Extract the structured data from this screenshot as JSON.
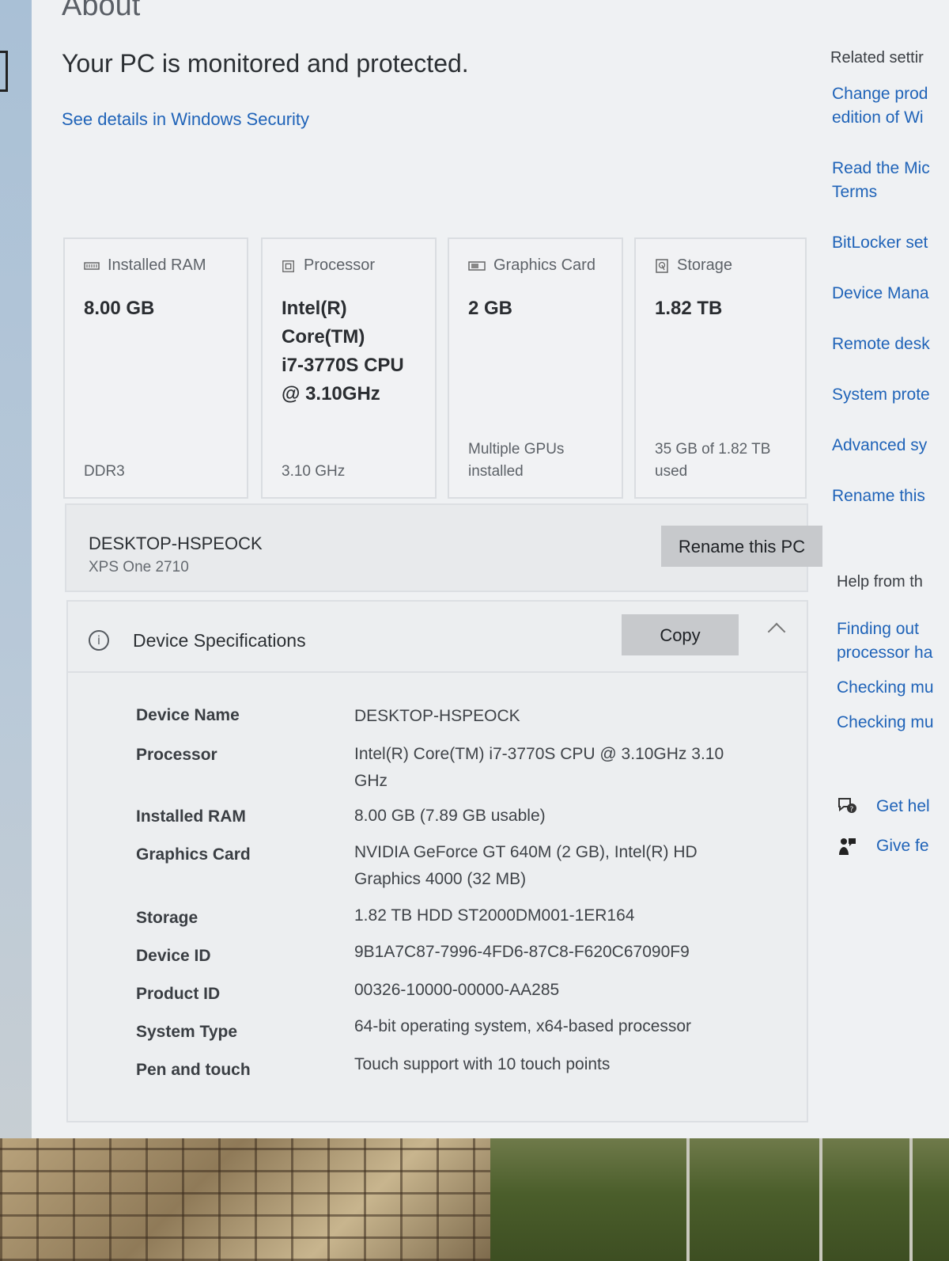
{
  "page": {
    "title": "About"
  },
  "security": {
    "status": "Your PC is monitored and protected.",
    "link": "See details in Windows Security"
  },
  "cards": [
    {
      "header": "Installed RAM",
      "icon": "ram-icon",
      "value": "8.00 GB",
      "footer": "DDR3"
    },
    {
      "header": "Processor",
      "icon": "processor-icon",
      "value": "Intel(R)\nCore(TM)\ni7-3770S CPU\n@ 3.10GHz",
      "footer": "3.10 GHz"
    },
    {
      "header": "Graphics Card",
      "icon": "graphics-card-icon",
      "value": "2 GB",
      "footer": "Multiple GPUs\ninstalled"
    },
    {
      "header": "Storage",
      "icon": "storage-icon",
      "value": "1.82 TB",
      "footer": "35 GB of 1.82 TB\nused"
    }
  ],
  "rename_panel": {
    "pc_name": "DESKTOP-HSPEOCK",
    "model": "XPS One 2710",
    "button": "Rename this PC"
  },
  "specs": {
    "title": "Device Specifications",
    "copy_button": "Copy",
    "rows": [
      {
        "label": "Device Name",
        "value": "DESKTOP-HSPEOCK"
      },
      {
        "label": "Processor",
        "value": "Intel(R) Core(TM) i7-3770S CPU @ 3.10GHz   3.10 GHz"
      },
      {
        "label": "Installed RAM",
        "value": "8.00 GB (7.89 GB usable)"
      },
      {
        "label": "Graphics Card",
        "value": "NVIDIA GeForce GT 640M (2 GB), Intel(R) HD Graphics 4000 (32 MB)"
      },
      {
        "label": "Storage",
        "value": "1.82 TB HDD ST2000DM001-1ER164"
      },
      {
        "label": "Device ID",
        "value": "9B1A7C87-7996-4FD6-87C8-F620C67090F9"
      },
      {
        "label": "Product ID",
        "value": "00326-10000-00000-AA285"
      },
      {
        "label": "System Type",
        "value": "64-bit operating system, x64-based processor"
      },
      {
        "label": "Pen and touch",
        "value": "Touch support with 10 touch points"
      }
    ]
  },
  "related": {
    "heading": "Related settir",
    "links": [
      "Change prod\nedition of Wi",
      "Read the Mic\nTerms",
      "BitLocker set",
      "Device Mana",
      "Remote desk",
      "System prote",
      "Advanced sy",
      "Rename this"
    ]
  },
  "help": {
    "heading": "Help from th",
    "links": [
      "Finding out\nprocessor ha",
      "Checking mu",
      "Checking mu"
    ],
    "get_help": "Get hel",
    "feedback": "Give fe"
  },
  "colors": {
    "link": "#1f63b8",
    "button": "#c7c9cc",
    "background": "#eff1f3"
  }
}
